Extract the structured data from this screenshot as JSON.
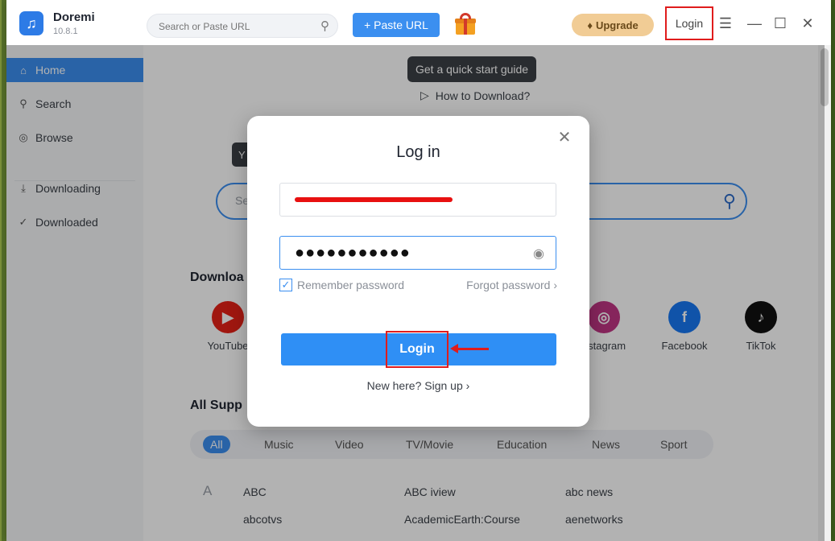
{
  "app": {
    "name": "Doremi",
    "version": "10.8.1"
  },
  "titlebar": {
    "search_placeholder": "Search or Paste URL",
    "paste_label": "+ Paste URL",
    "upgrade_label": "Upgrade",
    "login_label": "Login"
  },
  "sidebar": {
    "items": [
      {
        "label": "Home",
        "icon": "home-icon"
      },
      {
        "label": "Search",
        "icon": "search-icon"
      },
      {
        "label": "Browse",
        "icon": "compass-icon"
      },
      {
        "label": "Downloading",
        "icon": "download-icon"
      },
      {
        "label": "Downloaded",
        "icon": "check-circle-icon"
      }
    ]
  },
  "main": {
    "tip": "Get a quick start guide",
    "how_to": "How to Download?",
    "yt_tip": "Y",
    "search_lead": "Se",
    "download_title": "Downloa",
    "sites": [
      {
        "label": "YouTube",
        "color": "#e62117",
        "glyph": "▶"
      },
      {
        "label": "nstagram",
        "color": "#c13584",
        "glyph": "◎"
      },
      {
        "label": "Facebook",
        "color": "#1877f2",
        "glyph": "f"
      },
      {
        "label": "TikTok",
        "color": "#111111",
        "glyph": "♪"
      }
    ],
    "supported_title": "All Supp",
    "categories": [
      "All",
      "Music",
      "Video",
      "TV/Movie",
      "Education",
      "News",
      "Sport"
    ],
    "list_letter": "A",
    "list": [
      [
        "ABC",
        "ABC iview",
        "abc news"
      ],
      [
        "abcotvs",
        "AcademicEarth:Course",
        "aenetworks"
      ]
    ]
  },
  "modal": {
    "title": "Log in",
    "password_mask": "●●●●●●●●●●●",
    "remember_label": "Remember password",
    "forgot_label": "Forgot password ›",
    "login_button": "Login",
    "signup_text": "New here? Sign up ›"
  }
}
